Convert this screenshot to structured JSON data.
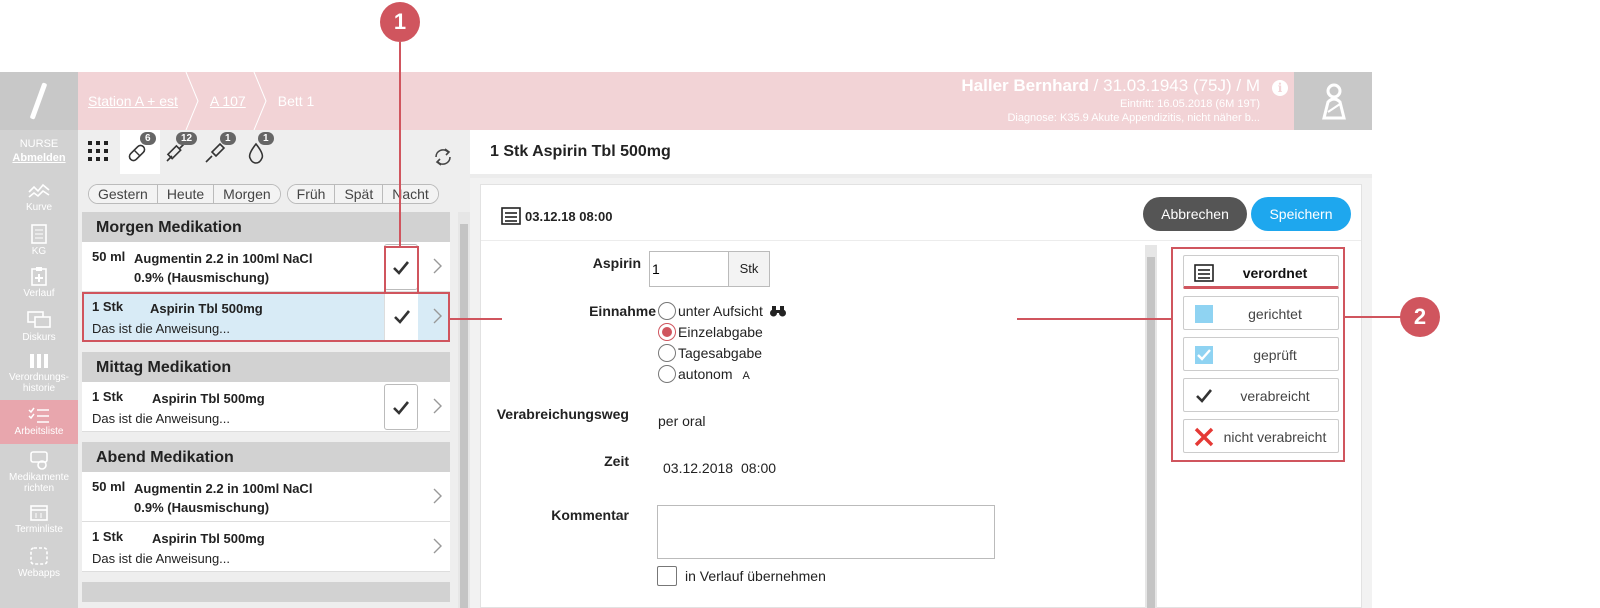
{
  "header": {
    "breadcrumbs": [
      {
        "label": "Station A + est",
        "link": true
      },
      {
        "label": "A 107",
        "link": true
      },
      {
        "label": "Bett 1",
        "link": false
      }
    ],
    "patient_name": "Haller Bernhard",
    "patient_details": " / 31.03.1943 (75J) / M",
    "admission": "Eintritt: 16.05.2018 (6M 19T)",
    "diagnosis": "Diagnose: K35.9 Akute Appendizitis, nicht näher b...",
    "info_glyph": "i"
  },
  "nav": {
    "role": "NURSE",
    "logout": "Abmelden",
    "items": [
      {
        "label": "Kurve",
        "icon": "chart-icon"
      },
      {
        "label": "KG",
        "icon": "document-icon"
      },
      {
        "label": "Verlauf",
        "icon": "clipboard-plus-icon"
      },
      {
        "label": "Diskurs",
        "icon": "chat-icon"
      },
      {
        "label": "Verordnungs-historie",
        "icon": "pills-history-icon"
      },
      {
        "label": "Arbeitsliste",
        "icon": "checklist-icon",
        "active": true
      },
      {
        "label": "Medikamente richten",
        "icon": "medication-icon"
      },
      {
        "label": "Terminliste",
        "icon": "calendar-icon"
      },
      {
        "label": "Webapps",
        "icon": "webapps-icon"
      }
    ]
  },
  "toolbar": {
    "badges": {
      "pills": "6",
      "syringe": "12",
      "pen": "1",
      "drop": "1"
    }
  },
  "day_filters": [
    "Gestern",
    "Heute",
    "Morgen"
  ],
  "time_filters": [
    "Früh",
    "Spät",
    "Nacht"
  ],
  "groups": [
    {
      "title": "Morgen Medikation",
      "items": [
        {
          "qty": "50 ml",
          "med": "Augmentin 2.2 in 100ml NaCl",
          "med2": "0.9% (Hausmischung)",
          "note": ""
        },
        {
          "qty": "1 Stk",
          "med": "Aspirin Tbl 500mg",
          "med2": "",
          "note": "Das ist die Anweisung..."
        }
      ]
    },
    {
      "title": "Mittag Medikation",
      "items": [
        {
          "qty": "1 Stk",
          "med": "Aspirin Tbl 500mg",
          "med2": "",
          "note": "Das ist die Anweisung..."
        }
      ]
    },
    {
      "title": "Abend Medikation",
      "items": [
        {
          "qty": "50 ml",
          "med": "Augmentin 2.2 in 100ml NaCl",
          "med2": "0.9% (Hausmischung)",
          "note": ""
        },
        {
          "qty": "1 Stk",
          "med": "Aspirin Tbl 500mg",
          "med2": "",
          "note": "Das ist die Anweisung..."
        }
      ]
    }
  ],
  "detail": {
    "title": "1 Stk Aspirin Tbl 500mg",
    "timestamp": "03.12.18 08:00",
    "cancel_label": "Abbrechen",
    "save_label": "Speichern",
    "med_label": "Aspirin",
    "qty_value": "1",
    "unit": "Stk",
    "intake_label": "Einnahme",
    "intake_options": [
      {
        "label": "unter Aufsicht",
        "selected": false
      },
      {
        "label": "Einzelabgabe",
        "selected": true
      },
      {
        "label": "Tagesabgabe",
        "selected": false
      },
      {
        "label": "autonom",
        "selected": false
      }
    ],
    "autonom_suffix": "A",
    "route_label": "Verabreichungsweg",
    "route_value": "per oral",
    "time_label": "Zeit",
    "time_date": "03.12.2018",
    "time_clock": "08:00",
    "comment_label": "Kommentar",
    "comment_value": "",
    "checkbox_label": "in Verlauf übernehmen"
  },
  "status_buttons": [
    {
      "label": "verordnet",
      "icon": "list-icon",
      "active": true
    },
    {
      "label": "gerichtet",
      "icon": "blue-square-icon",
      "active": false
    },
    {
      "label": "geprüft",
      "icon": "checked-square-icon",
      "active": false
    },
    {
      "label": "verabreicht",
      "icon": "checkmark-icon",
      "active": false
    },
    {
      "label": "nicht verabreicht",
      "icon": "red-x-icon",
      "active": false
    }
  ],
  "annotations": {
    "marker1": "1",
    "marker2": "2"
  },
  "colors": {
    "accent": "#d0555e",
    "header_bg": "#f2d3d6",
    "save_blue": "#1ea7ee"
  }
}
